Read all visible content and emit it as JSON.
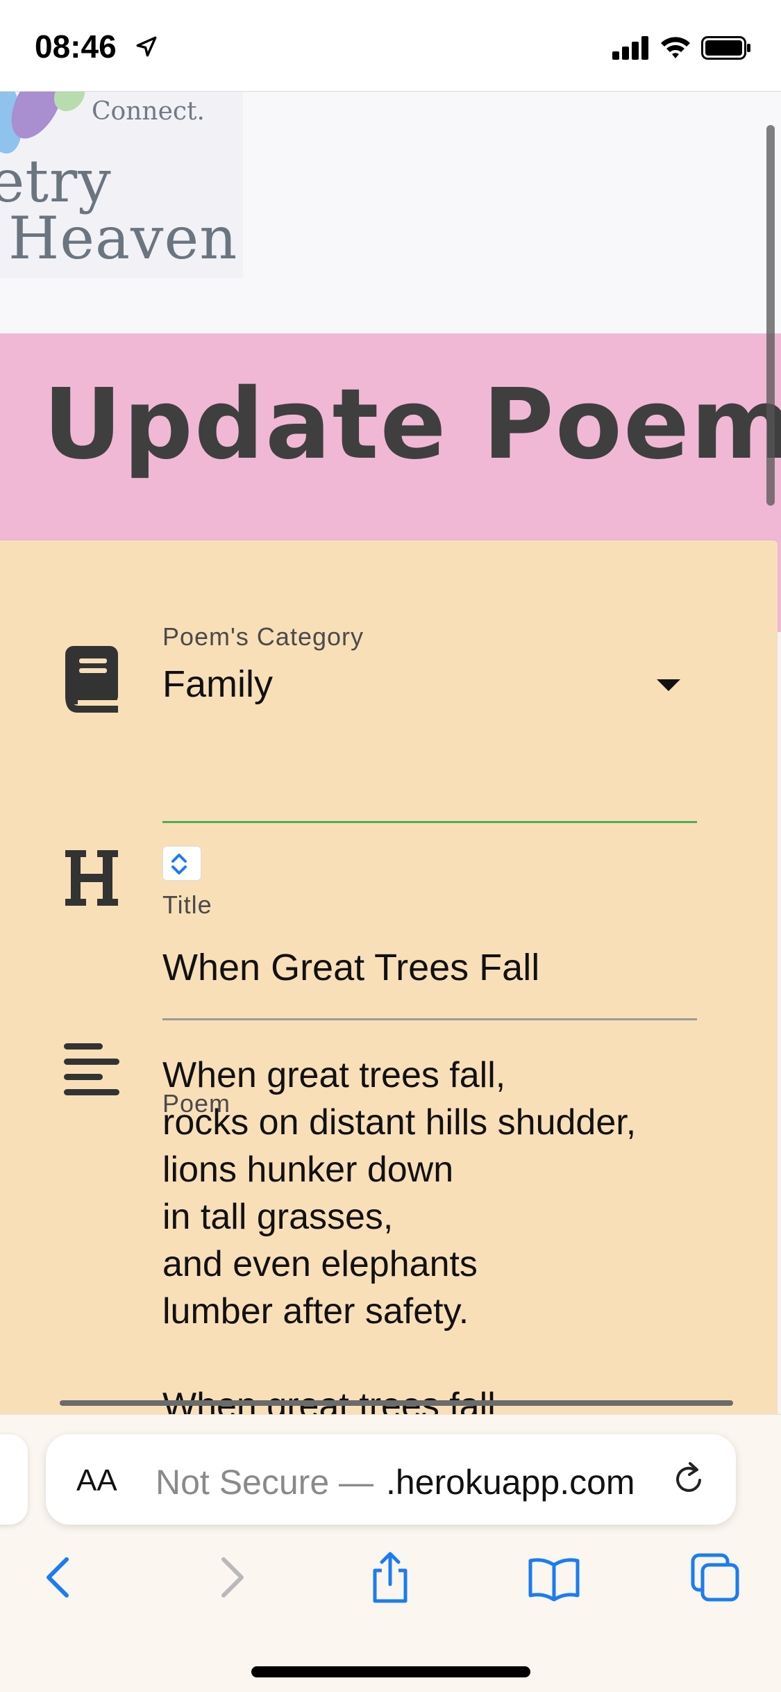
{
  "status_bar": {
    "time": "08:46"
  },
  "logo": {
    "tagline": "Connect.",
    "line1": "oetry",
    "line2": "Heaven"
  },
  "page": {
    "title": "Update Poem"
  },
  "form": {
    "category": {
      "label": "Poem's Category",
      "value": "Family"
    },
    "title_field": {
      "label": "Title",
      "value": "When Great Trees Fall"
    },
    "poem_field": {
      "label": "Poem",
      "value": "When great trees fall,\nrocks on distant hills shudder,\nlions hunker down\nin tall grasses,\nand even elephants\nlumber after safety.\n\nWhen great trees fall"
    }
  },
  "browser": {
    "aa_label": "AA",
    "url_prefix": "Not Secure — ",
    "url_host": " .herokuapp.com"
  },
  "colors": {
    "banner": "#f1b8d6",
    "card": "#f9dfb8",
    "accent_underline": "#4caf50",
    "ios_blue": "#1a7cf5"
  },
  "icons": {
    "category": "book-icon",
    "title": "heading-icon",
    "poem": "align-left-icon"
  }
}
